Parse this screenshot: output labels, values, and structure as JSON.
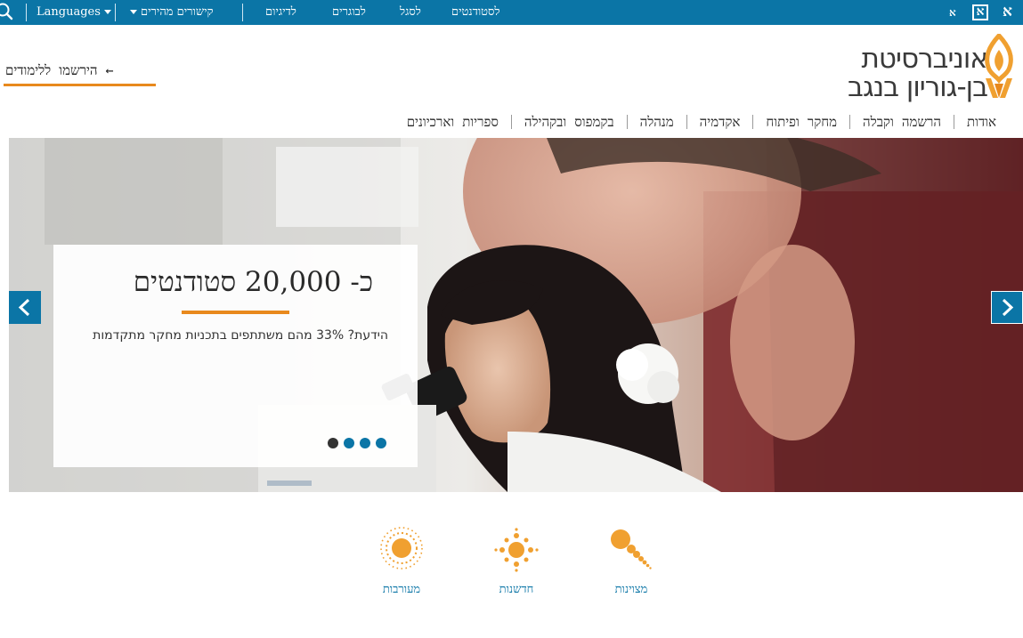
{
  "topbar": {
    "languages_label": "Languages",
    "quick_links_label": "קישורים מהירים",
    "links": [
      "לדיגיום",
      "לבוגרים",
      "לסגל",
      "לסטודנטים"
    ],
    "font_sizes": [
      "א",
      "א",
      "א"
    ]
  },
  "logo": {
    "line1": "אוניברסיטת",
    "line2": "בן-גוריון בנגב"
  },
  "header": {
    "register_label": "הירשמו ללימודים ←"
  },
  "nav": {
    "items": [
      "אודות",
      "הרשמה וקבלה",
      "מחקר ופיתוח",
      "אקדמיה",
      "מנהלה",
      "בקמפוס ובקהילה",
      "ספריות וארכיונים"
    ]
  },
  "hero": {
    "title": "כ- 20,000 סטודנטים",
    "text": "הידעת? 33% מהם משתתפים בתכניות מחקר מתקדמות",
    "slide_count": 4,
    "active_slide": 1
  },
  "features": [
    {
      "label": "מצוינות",
      "icon": "excellence-icon"
    },
    {
      "label": "חדשנות",
      "icon": "innovation-icon"
    },
    {
      "label": "מעורבות",
      "icon": "involvement-icon"
    }
  ],
  "colors": {
    "brand_blue": "#0b75a6",
    "accent_orange": "#e8891d"
  }
}
